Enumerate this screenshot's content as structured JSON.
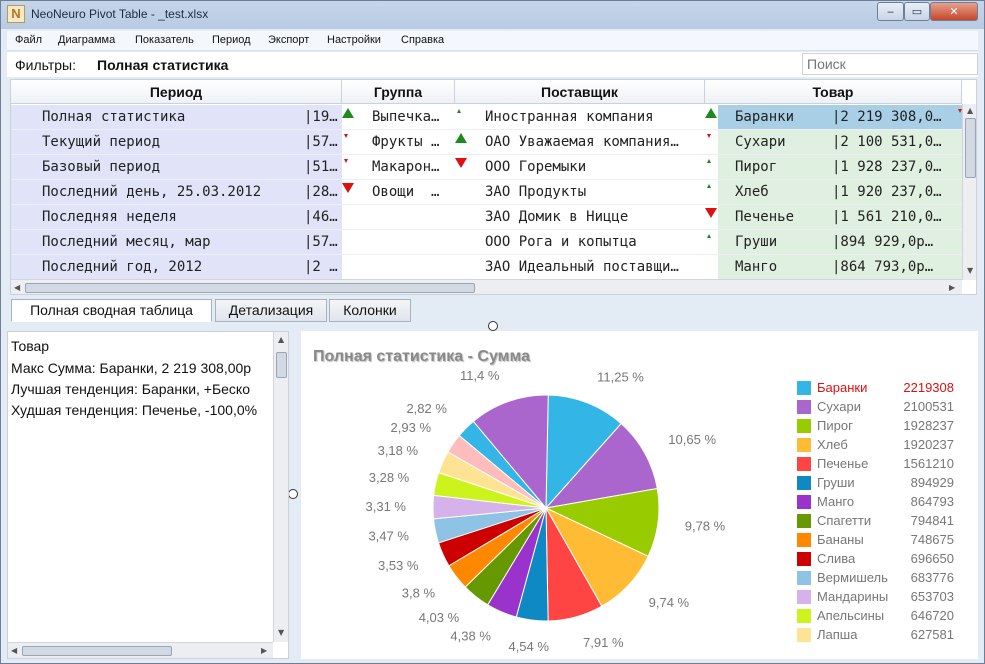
{
  "window": {
    "title": "NeoNeuro Pivot Table - _test.xlsx",
    "app_icon": "N",
    "min_label": "‒",
    "max_label": "▭",
    "close_label": "✕"
  },
  "menu": [
    "Файл",
    "Диаграмма",
    "Показатель",
    "Период",
    "Экспорт",
    "Настройки",
    "Справка"
  ],
  "filter": {
    "label": "Фильтры:",
    "value": "Полная статистика",
    "search_placeholder": "Поиск"
  },
  "grid": {
    "headers": {
      "period": "Период",
      "group": "Группа",
      "supplier": "Поставщик",
      "product": "Товар"
    },
    "periods": [
      {
        "name": "Полная статистика",
        "val": "|19…",
        "trend": "up-big"
      },
      {
        "name": "Текущий период",
        "val": "|57…",
        "trend": "down-small"
      },
      {
        "name": "Базовый период",
        "val": "|51…",
        "trend": "down-small"
      },
      {
        "name": "Последний день, 25.03.2012",
        "val": "|28…",
        "trend": "down-big"
      },
      {
        "name": "Последняя неделя",
        "val": "|46…",
        "trend": ""
      },
      {
        "name": "Последний месяц, мар",
        "val": "|57…",
        "trend": ""
      },
      {
        "name": "Последний год, 2012",
        "val": "|2 …",
        "trend": ""
      }
    ],
    "groups": [
      {
        "name": "Выпечка…",
        "trend": "up-small"
      },
      {
        "name": "Фрукты …",
        "trend": "up-big"
      },
      {
        "name": "Макарон…",
        "trend": "down-big"
      },
      {
        "name": "Овощи  …",
        "trend": ""
      }
    ],
    "suppliers": [
      {
        "name": "Иностранная компания",
        "trend": "up-big"
      },
      {
        "name": "ОАО Уважаемая компания…",
        "trend": "down-small"
      },
      {
        "name": "ООО Горемыки",
        "trend": "up-small"
      },
      {
        "name": "ЗАО Продукты",
        "trend": "up-small"
      },
      {
        "name": "ЗАО Домик в Ницце",
        "trend": "down-big"
      },
      {
        "name": "ООО Рога и копытца",
        "trend": "up-small"
      },
      {
        "name": "ЗАО Идеальный поставщи…",
        "trend": ""
      }
    ],
    "products": [
      {
        "name": "Баранки",
        "val": "|2 219 308,0…",
        "trend": "down-small"
      },
      {
        "name": "Сухари",
        "val": "|2 100 531,0…",
        "trend": ""
      },
      {
        "name": "Пирог",
        "val": "|1 928 237,0…",
        "trend": ""
      },
      {
        "name": "Хлеб",
        "val": "|1 920 237,0…",
        "trend": ""
      },
      {
        "name": "Печенье",
        "val": "|1 561 210,0…",
        "trend": ""
      },
      {
        "name": "Груши",
        "val": "|894 929,0р…",
        "trend": ""
      },
      {
        "name": "Манго",
        "val": "|864 793,0р…",
        "trend": ""
      }
    ]
  },
  "tabs": [
    "Полная сводная таблица",
    "Детализация",
    "Колонки"
  ],
  "info": {
    "lines": [
      "Товар",
      "Макс Сумма: Баранки, 2 219 308,00р",
      "Лучшая тенденция: Баранки, +Беско",
      "Худшая тенденция: Печенье, -100,0%"
    ]
  },
  "chart_data": {
    "type": "pie",
    "title": "Полная статистика - Сумма",
    "slices": [
      {
        "name": "Баранки",
        "value": 2219308,
        "label": "11,25 %",
        "color": "#33b5e5"
      },
      {
        "name": "Сухари",
        "value": 2100531,
        "label": "10,65 %",
        "color": "#aa66cc"
      },
      {
        "name": "Пирог",
        "value": 1928237,
        "label": "9,78 %",
        "color": "#99cc00"
      },
      {
        "name": "Хлеб",
        "value": 1920237,
        "label": "9,74 %",
        "color": "#ffbb33"
      },
      {
        "name": "Печенье",
        "value": 1561210,
        "label": "7,91 %",
        "color": "#ff4444"
      },
      {
        "name": "Груши",
        "value": 894929,
        "label": "4,54 %",
        "color": "#0f89c4"
      },
      {
        "name": "Манго",
        "value": 864793,
        "label": "4,38 %",
        "color": "#9933cc"
      },
      {
        "name": "Спагетти",
        "value": 794841,
        "label": "4,03 %",
        "color": "#669900"
      },
      {
        "name": "Бананы",
        "value": 748675,
        "label": "3,8 %",
        "color": "#ff8800"
      },
      {
        "name": "Слива",
        "value": 696650,
        "label": "3,53 %",
        "color": "#cc0000"
      },
      {
        "name": "Вермишель",
        "value": 683776,
        "label": "3,47 %",
        "color": "#8ec3e6"
      },
      {
        "name": "Мандарины",
        "value": 653703,
        "label": "3,31 %",
        "color": "#d5b3ea"
      },
      {
        "name": "Апельсины",
        "value": 646720,
        "label": "3,28 %",
        "color": "#ccf41c"
      },
      {
        "name": "Лапша",
        "value": 627581,
        "label": "3,18 %",
        "color": "#ffe394"
      },
      {
        "name": "",
        "value": 556000,
        "label": "2,93 %",
        "color": "#ffbcbc"
      },
      {
        "name": "",
        "value": 556000,
        "label": "2,82 %",
        "color": "#33b5e5"
      },
      {
        "name": "",
        "value": 2250000,
        "label": "11,4 %",
        "color": "#aa66cc"
      }
    ],
    "legend_highlight": "Баранки",
    "highlight_color": "#dd1111"
  }
}
